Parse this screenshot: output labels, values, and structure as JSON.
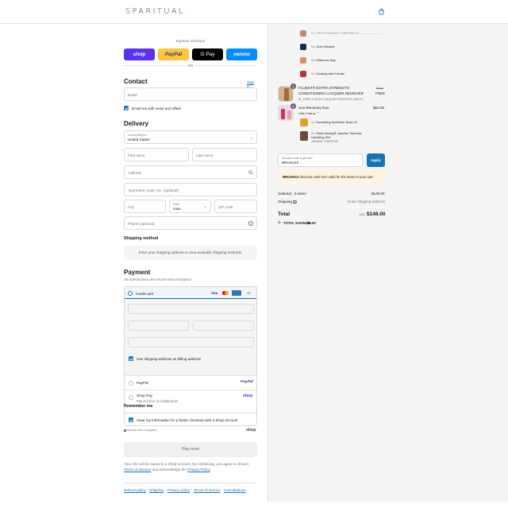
{
  "header": {
    "logo": "SPARITUAL."
  },
  "express": {
    "label": "Express checkout",
    "buttons": [
      "shop",
      "PayPal",
      "G Pay",
      "venmo"
    ],
    "or": "OR"
  },
  "contact": {
    "title": "Contact",
    "sign_in": "Sign in",
    "email_placeholder": "Email",
    "newsletter_label": "Email me with news and offers"
  },
  "delivery": {
    "title": "Delivery",
    "country_label": "Country/Region",
    "country_value": "United States",
    "first_name": "First name",
    "last_name": "Last name",
    "address": "Address",
    "apartment": "Apartment, suite, etc. (optional)",
    "city": "City",
    "state_label": "State",
    "state_value": "Iowa",
    "zip": "ZIP code",
    "phone": "Phone (optional)"
  },
  "shipping": {
    "title": "Shipping method",
    "info": "Enter your shipping address to view available shipping methods."
  },
  "payment": {
    "title": "Payment",
    "subtitle": "All transactions are secure and encrypted.",
    "credit_card": "Credit card",
    "card_brands": [
      "VISA",
      "MC",
      "AMEX",
      "+5"
    ],
    "billing_label": "Use shipping address as billing address",
    "paypal": "PayPal",
    "paypal_logo": "PayPal",
    "shop_pay": "Shop Pay",
    "shop_pay_sub": "Pay in full or in installments",
    "shop_logo": "shop"
  },
  "remember": {
    "title": "Remember me",
    "save_label": "Save my information for a faster checkout with a Shop account",
    "secure": "Secure and encrypted",
    "shop_logo": "shop"
  },
  "pay_now": "Pay now",
  "terms": {
    "text1": "Your info will be saved to a Shop account. By continuing, you agree to Shop's ",
    "tos": "Terms of Service",
    "text2": " and acknowledge the ",
    "privacy": "Privacy Policy",
    "text3": "."
  },
  "footer": {
    "links": [
      "Refund policy",
      "Shipping",
      "Privacy policy",
      "Terms of service",
      "Cancellations"
    ]
  },
  "cart": {
    "gift_items": [
      {
        "label": "1 × Citrus Cinnamon Cuticle Serum",
        "color": "#c98a6a"
      },
      {
        "label": "1 × Open Minded",
        "color": "#1e2a5a"
      },
      {
        "label": "1 × Afternoon Nap",
        "color": "#d69466"
      },
      {
        "label": "1 × Cooking with Friends",
        "color": "#b23a3a"
      }
    ],
    "product1": {
      "qty": "1",
      "name_line1": "FLUENT® EXTRA STRENGTH",
      "name_line2": "CONDITIONING LACQUER REMOVER",
      "discount": "FREE FLUENT LACQUER REMOVER (-$6.00)",
      "old_price": "$6.00",
      "price": "FREE"
    },
    "product2": {
      "qty": "1",
      "name": "Sun Recovery Duo",
      "price": "$53.00",
      "hide": "Hide 2 items",
      "sub_items": [
        {
          "label": "1 × Nourishing Sunflower Body Oil",
          "color": "#e0a030"
        },
        {
          "label": "1 × Shine Beauty® Jasmine Tuberose",
          "label2": "Hydrating Mist",
          "variant": "JASMINE TUBEROSE",
          "color": "#6a4a3a"
        }
      ]
    },
    "discount_label": "Discount code or gift card",
    "discount_value": "BRUSH10",
    "apply": "Apply",
    "error": "BRUSH10 discount code isn't valid for the items in your cart",
    "subtotal_label": "Subtotal · 5 items",
    "subtotal_value": "$148.00",
    "shipping_label": "Shipping",
    "shipping_value": "Enter shipping address",
    "total_label": "Total",
    "currency": "USD",
    "total_value": "$148.00",
    "savings_label": "TOTAL SAVINGS",
    "savings_value": "$6.00"
  },
  "colors": {
    "accent": "#1773b0",
    "shop_purple": "#5a31f4",
    "paypal_yellow": "#ffc439",
    "venmo_blue": "#008cff",
    "error_bg": "#fff4e0"
  }
}
